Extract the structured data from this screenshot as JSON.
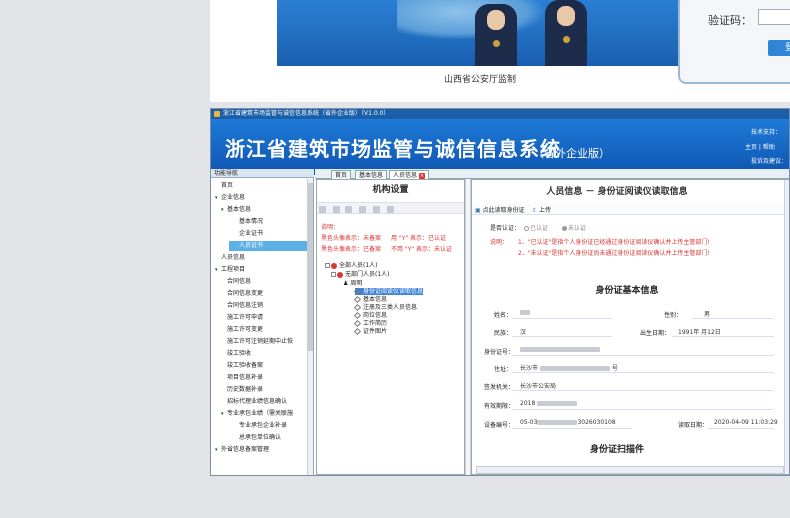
{
  "login_page": {
    "caption": "山西省公安厅监制",
    "captcha_label": "验证码：",
    "login_button": "登"
  },
  "app": {
    "window_title": "浙江省建筑市场监管与诚信信息系统（省外企业版）（V1.0.0）",
    "system_name": "浙江省建筑市场监管与诚信信息系统",
    "system_edition": "（省外企业版）",
    "header_right": [
      "技术支持：",
      "主页 | 帮助",
      "投诉及建议："
    ]
  },
  "nav": {
    "title": "功能导航",
    "items": [
      {
        "label": "首页",
        "level": 1,
        "arrow": ""
      },
      {
        "label": "企业信息",
        "level": 1,
        "arrow": "▾"
      },
      {
        "label": "基本信息",
        "level": 2,
        "arrow": "▾"
      },
      {
        "label": "基本情况",
        "level": 3,
        "arrow": ""
      },
      {
        "label": "企业证书",
        "level": 3,
        "arrow": ""
      },
      {
        "label": "人员证书",
        "level": 3,
        "arrow": "",
        "selected": true
      },
      {
        "label": "人员信息",
        "level": 1,
        "arrow": ""
      },
      {
        "label": "工程项目",
        "level": 1,
        "arrow": "▾"
      },
      {
        "label": "合同信息",
        "level": 2,
        "arrow": ""
      },
      {
        "label": "合同信息变更",
        "level": 2,
        "arrow": ""
      },
      {
        "label": "合同信息注销",
        "level": 2,
        "arrow": ""
      },
      {
        "label": "施工许可申请",
        "level": 2,
        "arrow": ""
      },
      {
        "label": "施工许可变更",
        "level": 2,
        "arrow": ""
      },
      {
        "label": "施工许可注销延期中止恢",
        "level": 2,
        "arrow": ""
      },
      {
        "label": "竣工验收",
        "level": 2,
        "arrow": ""
      },
      {
        "label": "竣工验收备案",
        "level": 2,
        "arrow": ""
      },
      {
        "label": "项目信息补录",
        "level": 2,
        "arrow": ""
      },
      {
        "label": "历史数据补录",
        "level": 2,
        "arrow": ""
      },
      {
        "label": "招标代理业绩信息确认",
        "level": 2,
        "arrow": ""
      },
      {
        "label": "专业承包业绩（需关联施",
        "level": 2,
        "arrow": "▾"
      },
      {
        "label": "专业承包企业补录",
        "level": 3,
        "arrow": ""
      },
      {
        "label": "总承包单位确认",
        "level": 3,
        "arrow": ""
      },
      {
        "label": "外省信息备案管理",
        "level": 1,
        "arrow": "▾"
      }
    ]
  },
  "tabs": [
    {
      "label": "首页",
      "active": false,
      "closable": false
    },
    {
      "label": "基本信息",
      "active": false,
      "closable": false
    },
    {
      "label": "人员信息",
      "active": true,
      "closable": true
    }
  ],
  "org_panel": {
    "title": "机构设置",
    "notes": [
      "说明：",
      "黑色头像表示：未备案",
      "用 \"Y\" 表示：已认证",
      "黑色头像表示：已备案",
      "不用 \"Y\" 表示：未认证"
    ],
    "tree": [
      {
        "label": "全部人员(1人)",
        "icon": "red"
      },
      {
        "label": "无部门人员(1人)",
        "icon": "red"
      },
      {
        "label": "周明",
        "icon": "person"
      },
      {
        "label": "身份证阅读仪读取信息",
        "icon": "dia",
        "highlight": true
      },
      {
        "label": "基本信息",
        "icon": "dia"
      },
      {
        "label": "注册及三类人员信息",
        "icon": "dia"
      },
      {
        "label": "岗位信息",
        "icon": "dia"
      },
      {
        "label": "工作简历",
        "icon": "dia"
      },
      {
        "label": "证件图片",
        "icon": "dia"
      }
    ]
  },
  "info_panel": {
    "title": "人员信息 － 身份证阅读仪读取信息",
    "toolbar": [
      "点此读取身份证",
      "上传"
    ],
    "auth_label": "是否认证：",
    "auth_options": [
      {
        "label": "已认证",
        "checked": false
      },
      {
        "label": "未认证",
        "checked": true
      }
    ],
    "note_label": "说明：",
    "note_lines": [
      "1、\"已认证\"是指个人身份证已经通过身份证阅读仪确认并上传主管部门!",
      "2、\"未认证\"是指个人身份证尚未通过身份证阅读仪确认并上传主管部门!"
    ],
    "card_title": "身份证基本信息",
    "fields": {
      "name_label": "姓名：",
      "gender_label": "性别：",
      "gender_value": "男",
      "ethnic_label": "民族：",
      "ethnic_value": "汉",
      "birth_label": "出生日期：",
      "birth_value": "1991年  月12日",
      "id_label": "身份证号：",
      "address_label": "住址：",
      "address_value": "长沙市",
      "address_tail": "号",
      "issuer_label": "签发机关：",
      "issuer_value": "长沙市公安局",
      "valid_label": "有效期限：",
      "valid_value": "2018",
      "device_label": "设备编号：",
      "device_value": "05-03",
      "device_tail": "3026030108",
      "readtime_label": "读取日期：",
      "readtime_value": "2020-04-09 11:03:29"
    },
    "scan_title": "身份证扫描件"
  },
  "colors": {
    "header_blue": "#1f7ad8",
    "selection_blue": "#5db0e6",
    "note_red": "#d33"
  }
}
